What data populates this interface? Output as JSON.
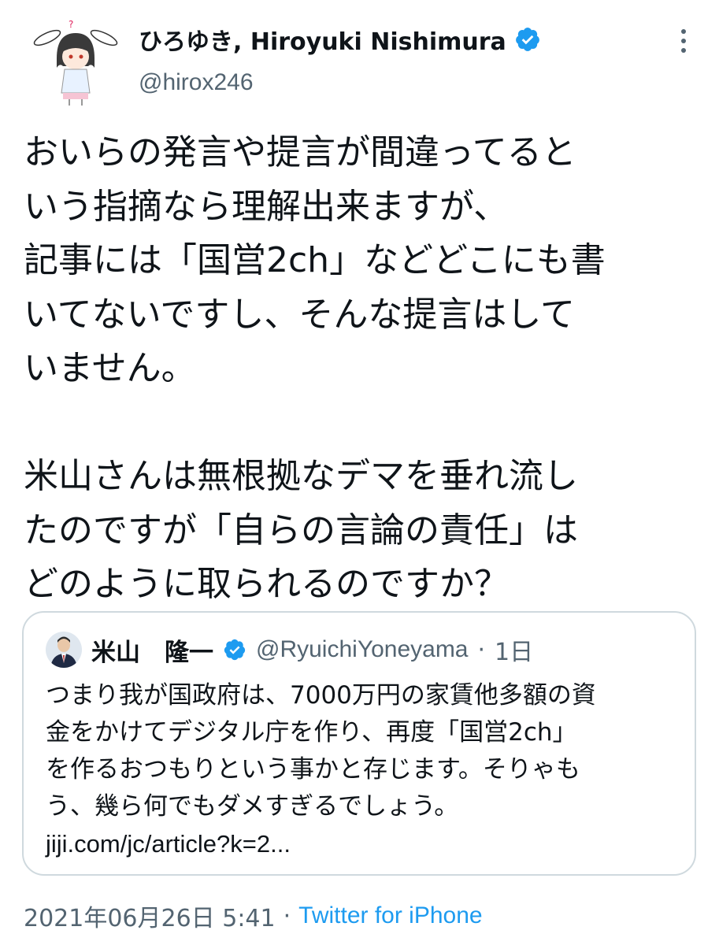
{
  "author": {
    "display_name": "ひろゆき, Hiroyuki Nishimura",
    "handle": "@hirox246",
    "verified": true,
    "avatar_icon": "anime-character-avatar",
    "more_icon": "vertical-ellipsis-icon"
  },
  "tweet": {
    "lines": [
      "おいらの発言や提言が間違ってると",
      "いう指摘なら理解出来ますが、",
      "記事には「国営2ch」などどこにも書",
      "いてないですし、そんな提言はして",
      "いません。",
      "",
      "米山さんは無根拠なデマを垂れ流し",
      "たのですが「自らの言論の責任」は",
      "どのように取られるのですか？"
    ]
  },
  "quoted_tweet": {
    "display_name": "米山　隆一",
    "handle": "@RyuichiYoneyama",
    "separator": "·",
    "time": "1日",
    "verified": true,
    "body_lines": [
      "つまり我が国政府は、7000万円の家賃他多額の資",
      "金をかけてデジタル庁を作り、再度「国営2ch」",
      "を作るおつもりという事かと存じます。そりゃも",
      "う、幾ら何でもダメすぎるでしょう。"
    ],
    "link": "jiji.com/jc/article?k=2..."
  },
  "footer": {
    "date": "2021年06月26日 5:41",
    "separator": "·",
    "source": "Twitter for iPhone"
  },
  "colors": {
    "text": "#0f1419",
    "secondary": "#536471",
    "accent": "#1d9bf0",
    "border": "#cfd9de"
  }
}
